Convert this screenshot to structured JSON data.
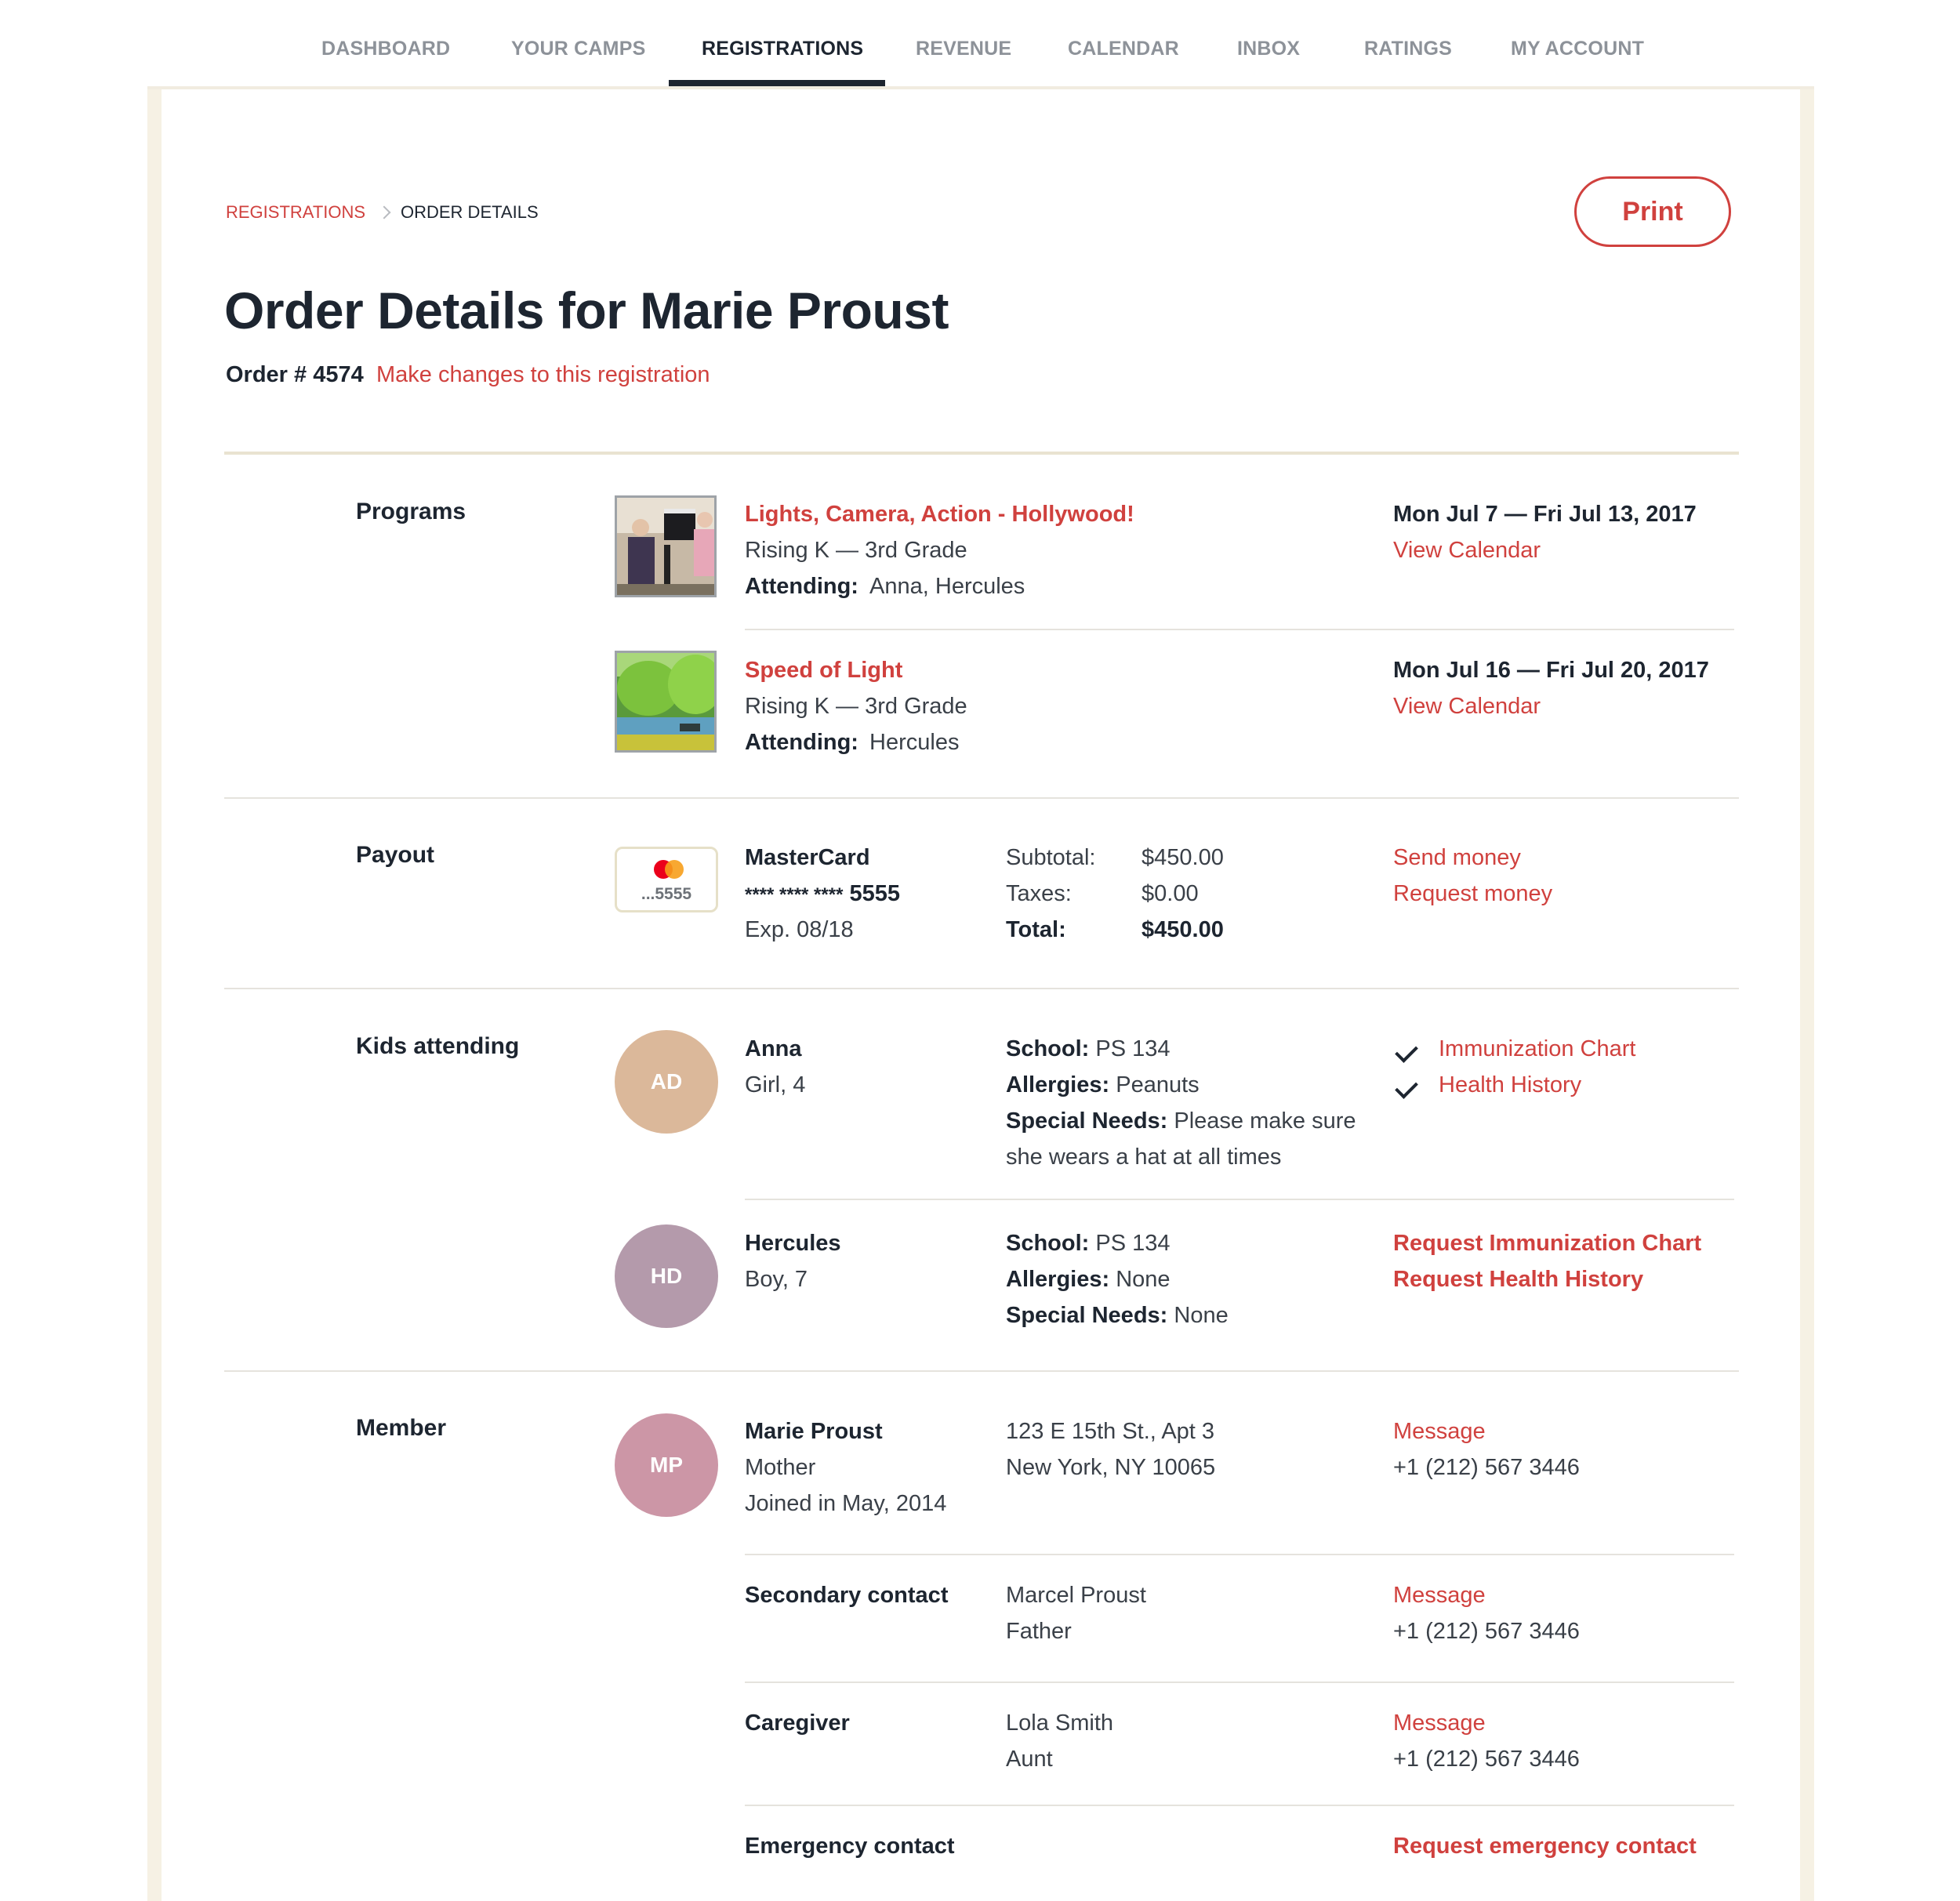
{
  "nav": {
    "items": [
      "DASHBOARD",
      "YOUR CAMPS",
      "REGISTRATIONS",
      "REVENUE",
      "CALENDAR",
      "INBOX",
      "RATINGS",
      "MY ACCOUNT"
    ],
    "active": "REGISTRATIONS"
  },
  "breadcrumb": {
    "parent": "REGISTRATIONS",
    "current": "ORDER DETAILS"
  },
  "print_label": "Print",
  "title": "Order Details for Marie Proust",
  "order": {
    "number_label": "Order # 4574",
    "edit_link": "Make changes to this registration"
  },
  "programs": {
    "label": "Programs",
    "items": [
      {
        "name": "Lights, Camera, Action - Hollywood!",
        "grades": "Rising K — 3rd Grade",
        "attending_label": "Attending:",
        "attending": "Anna, Hercules",
        "dates": "Mon Jul 7 — Fri Jul 13, 2017",
        "calendar_link": "View Calendar"
      },
      {
        "name": "Speed of Light",
        "grades": "Rising K — 3rd Grade",
        "attending_label": "Attending:",
        "attending": "Hercules",
        "dates": "Mon Jul 16 — Fri Jul 20, 2017",
        "calendar_link": "View Calendar"
      }
    ]
  },
  "payout": {
    "label": "Payout",
    "card_last4_badge": "...5555",
    "card_brand": "MasterCard",
    "card_mask": "**** **** ****",
    "card_last4": "5555",
    "card_exp": "Exp. 08/18",
    "subtotal_label": "Subtotal:",
    "subtotal": "$450.00",
    "taxes_label": "Taxes:",
    "taxes": "$0.00",
    "total_label": "Total:",
    "total": "$450.00",
    "send_link": "Send money",
    "request_link": "Request money"
  },
  "kids": {
    "label": "Kids attending",
    "items": [
      {
        "initials": "AD",
        "avatar_color": "#dbb89a",
        "name": "Anna",
        "detail": "Girl, 4",
        "school_label": "School:",
        "school": "PS 134",
        "allergies_label": "Allergies:",
        "allergies": "Peanuts",
        "needs_label": "Special Needs:",
        "needs_line1": "Please make sure",
        "needs_line2": "she wears a hat at all times",
        "doc1": "Immunization Chart",
        "doc2": "Health History"
      },
      {
        "initials": "HD",
        "avatar_color": "#b49aab",
        "name": "Hercules",
        "detail": "Boy, 7",
        "school_label": "School:",
        "school": "PS 134",
        "allergies_label": "Allergies:",
        "allergies": "None",
        "needs_label": "Special Needs:",
        "needs_line1": "None",
        "doc1": "Request Immunization Chart",
        "doc2": "Request Health History"
      }
    ]
  },
  "member": {
    "label": "Member",
    "initials": "MP",
    "avatar_color": "#cc96a6",
    "name": "Marie Proust",
    "relation": "Mother",
    "joined": "Joined in May, 2014",
    "address1": "123 E 15th St., Apt 3",
    "address2": "New York, NY 10065",
    "message_link": "Message",
    "phone": "+1 (212) 567 3446",
    "contacts": [
      {
        "label": "Secondary contact",
        "name": "Marcel Proust",
        "relation": "Father",
        "message_link": "Message",
        "phone": "+1 (212) 567 3446"
      },
      {
        "label": "Caregiver",
        "name": "Lola Smith",
        "relation": "Aunt",
        "message_link": "Message",
        "phone": "+1 (212) 567 3446"
      }
    ],
    "emergency_label": "Emergency contact",
    "emergency_link": "Request emergency contact"
  },
  "colors": {
    "accent": "#d0413e",
    "text": "#1d2530",
    "muted_nav": "#8d9299"
  }
}
